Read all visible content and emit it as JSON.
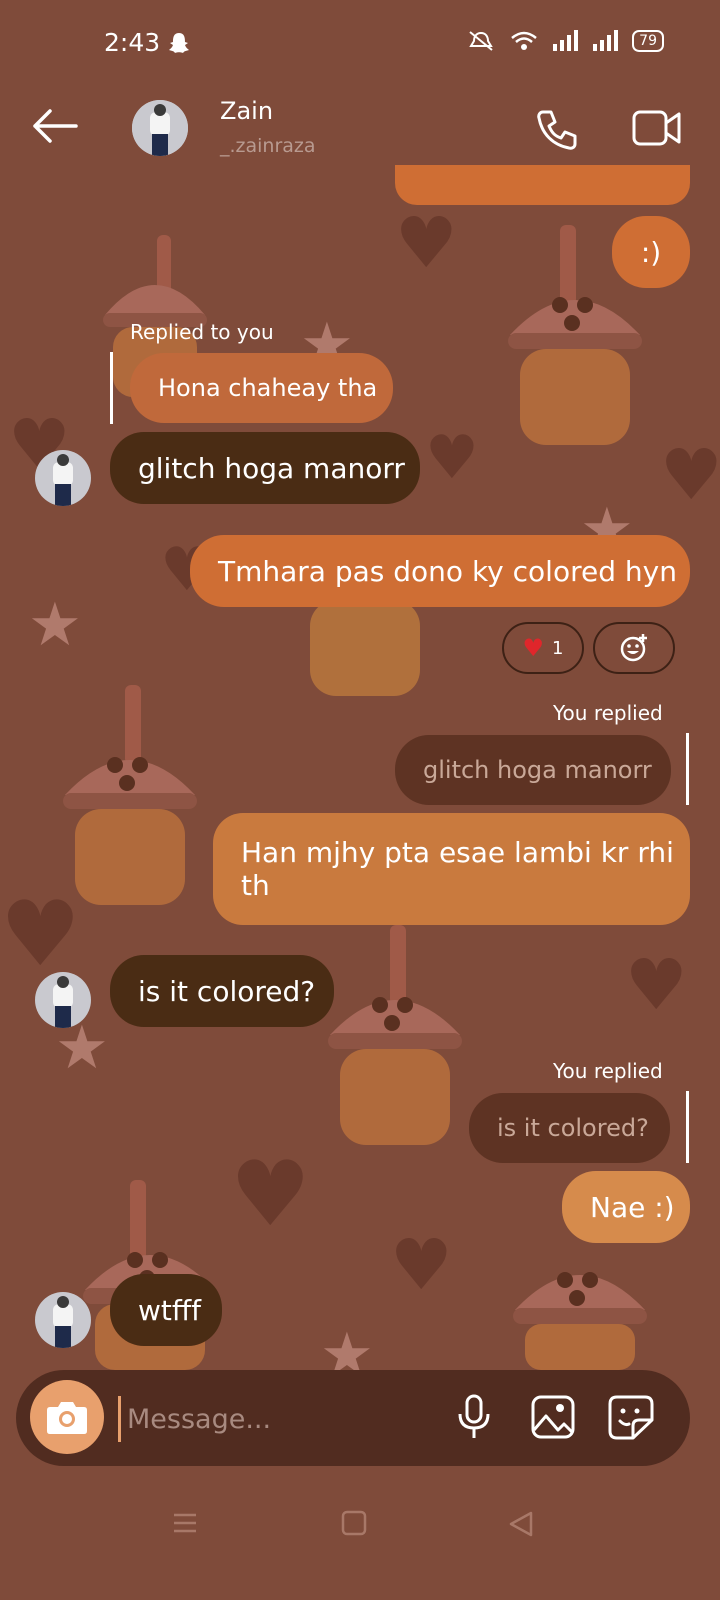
{
  "status_bar": {
    "time": "2:43",
    "battery": "79"
  },
  "header": {
    "name": "Zain",
    "handle": "_.zainraza"
  },
  "messages": {
    "m1_text": ":)",
    "reply1_label": "Replied to you",
    "reply1_quote": "Hona chaheay tha",
    "m2_text": "glitch hoga manorr",
    "m3_text": "Tmhara pas dono ky colored hyn",
    "m3_reaction_count": "1",
    "reply2_label": "You replied",
    "reply2_quote": "glitch hoga manorr",
    "m4_line1": "Han mjhy pta esae lambi kr rhi",
    "m4_line2": "th",
    "m5_text": "is it colored?",
    "reply3_label": "You replied",
    "reply3_quote": "is it colored?",
    "m6_text": "Nae :)",
    "m7_text": "wtfff"
  },
  "composer": {
    "placeholder": "Message..."
  },
  "icons": {
    "back": "arrow-left-icon",
    "call": "phone-icon",
    "video": "video-camera-icon",
    "camera": "camera-icon",
    "mic": "microphone-icon",
    "gallery": "image-icon",
    "sticker": "sticker-icon",
    "reaction": "add-emoji-icon"
  },
  "colors": {
    "background": "#7f4b3a",
    "incoming": "#4a2c14",
    "outgoing": "#cf6e34",
    "accent": "#e8a06d"
  }
}
